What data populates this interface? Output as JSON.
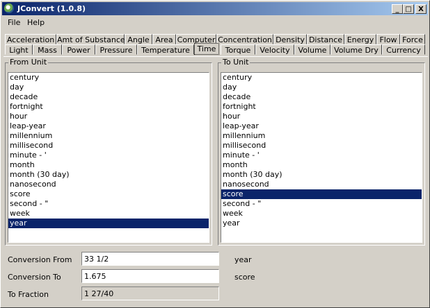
{
  "window": {
    "title": "JConvert (1.0.8)"
  },
  "title_buttons": {
    "minimize": "_",
    "maximize": "□",
    "close": "X"
  },
  "menu": {
    "file": "File",
    "help": "Help"
  },
  "tabs_row1": [
    "Acceleration",
    "Amt of Substance",
    "Angle",
    "Area",
    "Computer",
    "Concentration",
    "Density",
    "Distance",
    "Energy",
    "Flow",
    "Force"
  ],
  "tabs_row2": [
    "Light",
    "Mass",
    "Power",
    "Pressure",
    "Temperature",
    "Time",
    "Torque",
    "Velocity",
    "Volume",
    "Volume Dry",
    "Currency"
  ],
  "active_tab": "Time",
  "from_unit": {
    "label": "From Unit",
    "items": [
      "century",
      "day",
      "decade",
      "fortnight",
      "hour",
      "leap-year",
      "millennium",
      "millisecond",
      "minute - '",
      "month",
      "month (30 day)",
      "nanosecond",
      "score",
      "second - \"",
      "week",
      "year"
    ],
    "selected": "year"
  },
  "to_unit": {
    "label": "To Unit",
    "items": [
      "century",
      "day",
      "decade",
      "fortnight",
      "hour",
      "leap-year",
      "millennium",
      "millisecond",
      "minute - '",
      "month",
      "month (30 day)",
      "nanosecond",
      "score",
      "second - \"",
      "week",
      "year"
    ],
    "selected": "score"
  },
  "conversion": {
    "from_label": "Conversion From",
    "from_value": "33 1/2",
    "from_unit": "year",
    "to_label": "Conversion To",
    "to_value": "1.675",
    "to_unit": "score",
    "fraction_label": "To Fraction",
    "fraction_value": "1 27/40"
  },
  "colors": {
    "titlebar": "#0a246a",
    "selection": "#0a246a",
    "window_bg": "#d4d0c8"
  }
}
